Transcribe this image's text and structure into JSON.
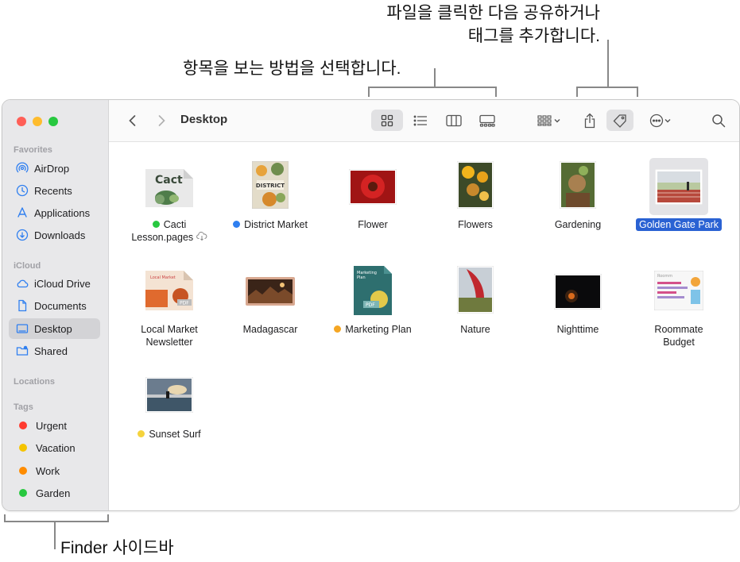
{
  "callouts": {
    "share_tag_line1": "파일을 클릭한 다음 공유하거나",
    "share_tag_line2": "태그를 추가합니다.",
    "view_options": "항목을 보는 방법을 선택합니다.",
    "sidebar_label": "Finder 사이드바"
  },
  "window": {
    "title": "Desktop"
  },
  "sidebar": {
    "favorites_header": "Favorites",
    "favorites": [
      {
        "label": "AirDrop",
        "icon": "airdrop-icon"
      },
      {
        "label": "Recents",
        "icon": "clock-icon"
      },
      {
        "label": "Applications",
        "icon": "applications-icon"
      },
      {
        "label": "Downloads",
        "icon": "download-icon"
      }
    ],
    "icloud_header": "iCloud",
    "icloud": [
      {
        "label": "iCloud Drive",
        "icon": "cloud-icon"
      },
      {
        "label": "Documents",
        "icon": "document-icon"
      },
      {
        "label": "Desktop",
        "icon": "desktop-icon"
      },
      {
        "label": "Shared",
        "icon": "shared-folder-icon"
      }
    ],
    "locations_header": "Locations",
    "tags_header": "Tags",
    "tags": [
      {
        "label": "Urgent",
        "color": "#ff3b30"
      },
      {
        "label": "Vacation",
        "color": "#f5c400"
      },
      {
        "label": "Work",
        "color": "#ff8c00"
      },
      {
        "label": "Garden",
        "color": "#28c840"
      }
    ]
  },
  "colors": {
    "accent": "#2a62d3",
    "close": "#ff5f57",
    "minimize": "#febc2e",
    "zoom": "#28c840"
  },
  "files": [
    {
      "line1": "Cacti",
      "line2": "Lesson.pages",
      "tag": "#28c840",
      "cloud": true
    },
    {
      "line1": "District Market",
      "line2": "",
      "tag": "#2f7ff0"
    },
    {
      "line1": "Flower",
      "line2": ""
    },
    {
      "line1": "Flowers",
      "line2": ""
    },
    {
      "line1": "Gardening",
      "line2": ""
    },
    {
      "line1": "Golden Gate Park",
      "line2": "",
      "selected": true
    },
    {
      "line1": "Local Market",
      "line2": "Newsletter"
    },
    {
      "line1": "Madagascar",
      "line2": ""
    },
    {
      "line1": "Marketing Plan",
      "line2": "",
      "tag": "#f5a623"
    },
    {
      "line1": "Nature",
      "line2": ""
    },
    {
      "line1": "Nighttime",
      "line2": ""
    },
    {
      "line1": "Roommate",
      "line2": "Budget"
    },
    {
      "line1": "Sunset Surf",
      "line2": "",
      "tag": "#f5d33d"
    }
  ]
}
